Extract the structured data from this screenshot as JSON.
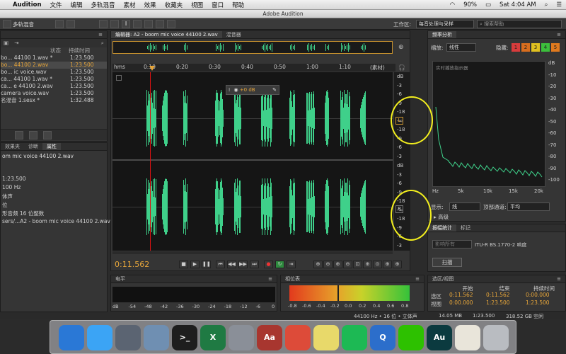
{
  "menubar": {
    "app": "Audition",
    "items": [
      "文件",
      "编辑",
      "多轨混音",
      "素材",
      "效果",
      "收藏夹",
      "视图",
      "窗口",
      "帮助"
    ],
    "battery": "90%",
    "clock": "Sat 4:04 AM"
  },
  "window": {
    "title": "Adobe Audition"
  },
  "toolbar": {
    "mode": "多轨混音",
    "workspace_label": "工作区:",
    "workspace_value": "每音处理与采样",
    "search_placeholder": "搜索帮助"
  },
  "files": {
    "columns": [
      "状态",
      "持续时间"
    ],
    "rows": [
      {
        "name": "bo... 44100 1.wav *",
        "dur": "1:23.500"
      },
      {
        "name": "bo... 44100 2.wav",
        "dur": "1:23.500"
      },
      {
        "name": "bo... ic voice.wav",
        "dur": "1:23.500"
      },
      {
        "name": "ca... 44100 1.wav *",
        "dur": "1:23.500"
      },
      {
        "name": "ca... e 44100 2.wav",
        "dur": "1:23.500"
      },
      {
        "name": "camera voice.wav",
        "dur": "1:23.500"
      },
      {
        "name": "名混音 1.sesx *",
        "dur": "1:32.488"
      }
    ]
  },
  "props": {
    "tabs": [
      "效果夹",
      "诊断",
      "属性"
    ],
    "filename": "om mic voice 44100 2.wav",
    "lines": [
      "1:23.500",
      "100 Hz",
      "体声",
      "位",
      "形音频 16 位整数",
      "sers/...A2 - boom mic voice 44100 2.wav"
    ]
  },
  "editor": {
    "tabs": [
      "编辑器: A2 - boom mic voice 44100 2.wav",
      "混音器"
    ],
    "ruler_unit": "hms",
    "ruler_end": "(素材)",
    "ruler_ticks": [
      "0:10",
      "0:20",
      "0:30",
      "0:40",
      "0:50",
      "1:00",
      "1:10"
    ],
    "hud_gain": "+0 dB",
    "db_ticks_top": [
      "dB",
      "-3",
      "-6",
      "-9",
      "-18",
      "-∞",
      "-18",
      "-9",
      "-6",
      "-3"
    ],
    "db_ticks_bottom": [
      "dB",
      "-3",
      "-6",
      "-9",
      "-18",
      "-∞",
      "-18",
      "-9",
      "-6",
      "-3"
    ],
    "channel_left": "L",
    "channel_right": "R",
    "time": "0:11.562"
  },
  "freq": {
    "title": "频率分析",
    "scale_label": "缩放:",
    "scale_value": "线性",
    "hold_label": "隐藏:",
    "holds": [
      "1",
      "2",
      "3",
      "4",
      "5"
    ],
    "hold_colors": [
      "#d83c3c",
      "#d86e1e",
      "#e0c020",
      "#3cbf3c",
      "#e07a1e"
    ],
    "overlay": "实时播放指示器",
    "y_ticks": [
      "dB",
      "-10",
      "-20",
      "-30",
      "-40",
      "-50",
      "-60",
      "-70",
      "-80",
      "-90",
      "-100"
    ],
    "x_ticks": [
      "Hz",
      "5k",
      "10k",
      "15k",
      "20k"
    ],
    "display_label": "显示:",
    "display_value": "线",
    "top_channel_label": "顶部通道:",
    "top_channel_value": "平均",
    "advanced": "高级"
  },
  "stats": {
    "tabs": [
      "振幅统计",
      "标记"
    ],
    "mode": "影响所有",
    "standard": "ITU-R BS.1770-2 响度",
    "scan": "扫描"
  },
  "level": {
    "title": "电平",
    "ticks": [
      "dB",
      "-54",
      "-48",
      "-42",
      "-36",
      "-30",
      "-24",
      "-18",
      "-12",
      "-6",
      "0"
    ]
  },
  "phase": {
    "title": "相位表",
    "ticks": [
      "-0.8",
      "-0.6",
      "-0.4",
      "-0.2",
      "0.0",
      "0.2",
      "0.4",
      "0.6",
      "0.8"
    ]
  },
  "selection": {
    "title": "选区/视图",
    "cols": [
      "开始",
      "结束",
      "持续时间"
    ],
    "sel_label": "选区",
    "view_label": "视图",
    "sel": [
      "0:11.562",
      "0:11.562",
      "0:00.000"
    ],
    "view": [
      "0:00.000",
      "1:23.500",
      "1:23.500"
    ]
  },
  "status": {
    "text": "44100 Hz • 16 位 • 立体声",
    "size": "14.05 MB",
    "dur": "1:23.500",
    "free": "318.52 GB 空闲"
  },
  "dock": [
    {
      "name": "finder-icon",
      "label": "",
      "color": "#2a78d6"
    },
    {
      "name": "messages-icon",
      "label": "",
      "color": "#3ba4f5"
    },
    {
      "name": "launchpad-icon",
      "label": "",
      "color": "#5b6472"
    },
    {
      "name": "preview-icon",
      "label": "",
      "color": "#6f8fb2"
    },
    {
      "name": "terminal-icon",
      "label": ">_",
      "color": "#1e1e1e"
    },
    {
      "name": "excel-icon",
      "label": "X",
      "color": "#1f7a43"
    },
    {
      "name": "system-preferences-icon",
      "label": "",
      "color": "#8a8f98"
    },
    {
      "name": "dictionary-icon",
      "label": "Aa",
      "color": "#a8362f"
    },
    {
      "name": "chrome-icon",
      "label": "",
      "color": "#dd4b39"
    },
    {
      "name": "stickies-icon",
      "label": "",
      "color": "#e8d96a"
    },
    {
      "name": "spotify-icon",
      "label": "",
      "color": "#1db954"
    },
    {
      "name": "quicktime-icon",
      "label": "Q",
      "color": "#2c6ecb"
    },
    {
      "name": "wechat-icon",
      "label": "",
      "color": "#2dc100"
    },
    {
      "name": "audition-icon",
      "label": "Au",
      "color": "#0b3a3f"
    },
    {
      "name": "textedit-icon",
      "label": "",
      "color": "#e9e5da"
    },
    {
      "name": "trash-icon",
      "label": "",
      "color": "#b9bcc1"
    }
  ]
}
